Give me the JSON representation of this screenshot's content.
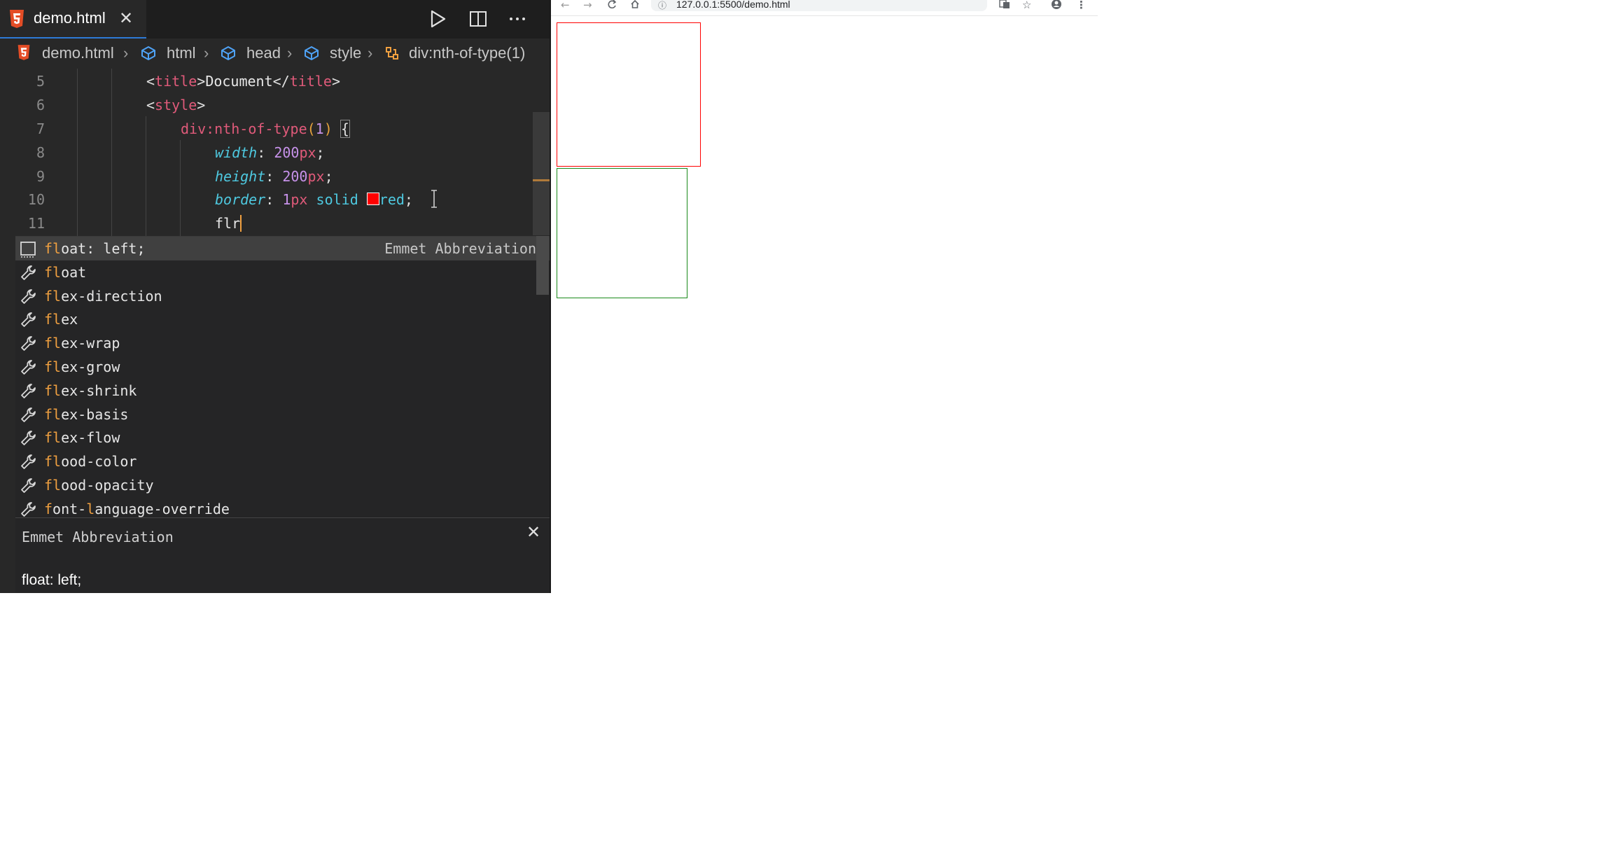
{
  "editor": {
    "tab": {
      "label": "demo.html",
      "close": "✕"
    },
    "breadcrumb": [
      "demo.html",
      "html",
      "head",
      "style",
      "div:nth-of-type(1)"
    ],
    "code": {
      "line_numbers": [
        "5",
        "6",
        "7",
        "8",
        "9",
        "10",
        "11"
      ],
      "lines": {
        "l5": {
          "open_lt": "<",
          "tag": "title",
          "open_gt": ">",
          "text": "Document",
          "close_lt": "</",
          "close_tag": "title",
          "close_gt": ">"
        },
        "l6": {
          "lt": "<",
          "tag": "style",
          "gt": ">"
        },
        "l7": {
          "selector": "div:nth-of-type",
          "lparen": "(",
          "arg": "1",
          "rparen": ")",
          "brace": "{"
        },
        "l8": {
          "prop": "width",
          "colon": ": ",
          "num": "200",
          "unit": "px",
          "semi": ";"
        },
        "l9": {
          "prop": "height",
          "colon": ": ",
          "num": "200",
          "unit": "px",
          "semi": ";"
        },
        "l10": {
          "prop": "border",
          "colon": ": ",
          "num": "1",
          "unit": "px",
          "kw": "solid",
          "color": "red",
          "semi": ";",
          "swatch_color": "#ff0000"
        },
        "l11": {
          "typed": "flr"
        }
      }
    },
    "suggestions": [
      {
        "pre": "",
        "hl": "fl",
        "post": "oat: left;",
        "detail": "Emmet Abbreviation",
        "icon": "emmet-snippet-icon",
        "selected": true
      },
      {
        "pre": "",
        "hl": "fl",
        "post": "oat",
        "detail": "",
        "icon": "wrench-icon"
      },
      {
        "pre": "",
        "hl": "fl",
        "post": "ex-direction",
        "detail": "",
        "icon": "wrench-icon"
      },
      {
        "pre": "",
        "hl": "fl",
        "post": "ex",
        "detail": "",
        "icon": "wrench-icon"
      },
      {
        "pre": "",
        "hl": "fl",
        "post": "ex-wrap",
        "detail": "",
        "icon": "wrench-icon"
      },
      {
        "pre": "",
        "hl": "fl",
        "post": "ex-grow",
        "detail": "",
        "icon": "wrench-icon"
      },
      {
        "pre": "",
        "hl": "fl",
        "post": "ex-shrink",
        "detail": "",
        "icon": "wrench-icon"
      },
      {
        "pre": "",
        "hl": "fl",
        "post": "ex-basis",
        "detail": "",
        "icon": "wrench-icon"
      },
      {
        "pre": "",
        "hl": "fl",
        "post": "ex-flow",
        "detail": "",
        "icon": "wrench-icon"
      },
      {
        "pre": "",
        "hl": "fl",
        "post": "ood-color",
        "detail": "",
        "icon": "wrench-icon"
      },
      {
        "pre": "",
        "hl": "fl",
        "post": "ood-opacity",
        "detail": "",
        "icon": "wrench-icon"
      },
      {
        "pre": "",
        "hl": "f",
        "post": "ont-",
        "hl2": "l",
        "post2": "anguage-override",
        "detail": "",
        "icon": "wrench-icon"
      }
    ],
    "details": {
      "title": "Emmet Abbreviation",
      "close": "✕",
      "body": "float: left;"
    }
  },
  "browser": {
    "url": "127.0.0.1:5500/demo.html",
    "box1_border_color": "#ff0000",
    "box2_border_color": "#1a8a1a"
  },
  "colors": {
    "accent": "#2d7ad6",
    "match_highlight": "#f0a040"
  }
}
